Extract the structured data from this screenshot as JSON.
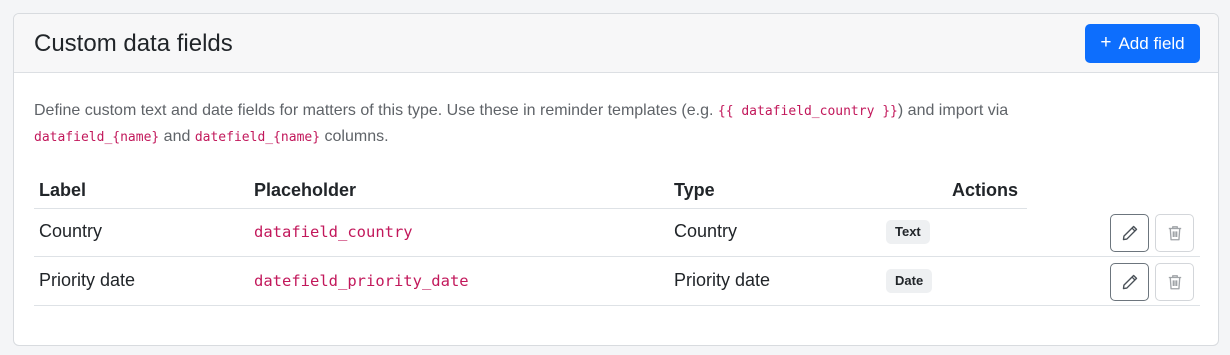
{
  "card": {
    "title": "Custom data fields",
    "add_button_label": "Add field",
    "description": {
      "part1": "Define custom text and date fields for matters of this type. Use these in reminder templates (e.g. ",
      "code1": "{{ datafield_country }}",
      "part2": ") and import via",
      "code2": "datafield_{name}",
      "part3": " and ",
      "code3": "datefield_{name}",
      "part4": " columns."
    }
  },
  "table": {
    "headers": {
      "label": "Label",
      "placeholder": "Placeholder",
      "type": "Type",
      "actions": "Actions"
    },
    "rows": [
      {
        "label": "Country",
        "placeholder": "datafield_country",
        "type": "Country",
        "badge": "Text"
      },
      {
        "label": "Priority date",
        "placeholder": "datefield_priority_date",
        "type": "Priority date",
        "badge": "Date"
      }
    ]
  },
  "colors": {
    "primary": "#0d6efd",
    "code": "#c2185b",
    "muted_text": "#5f6368"
  },
  "icons": {
    "add": "plus-icon",
    "edit": "pencil-icon",
    "delete": "trash-icon"
  }
}
